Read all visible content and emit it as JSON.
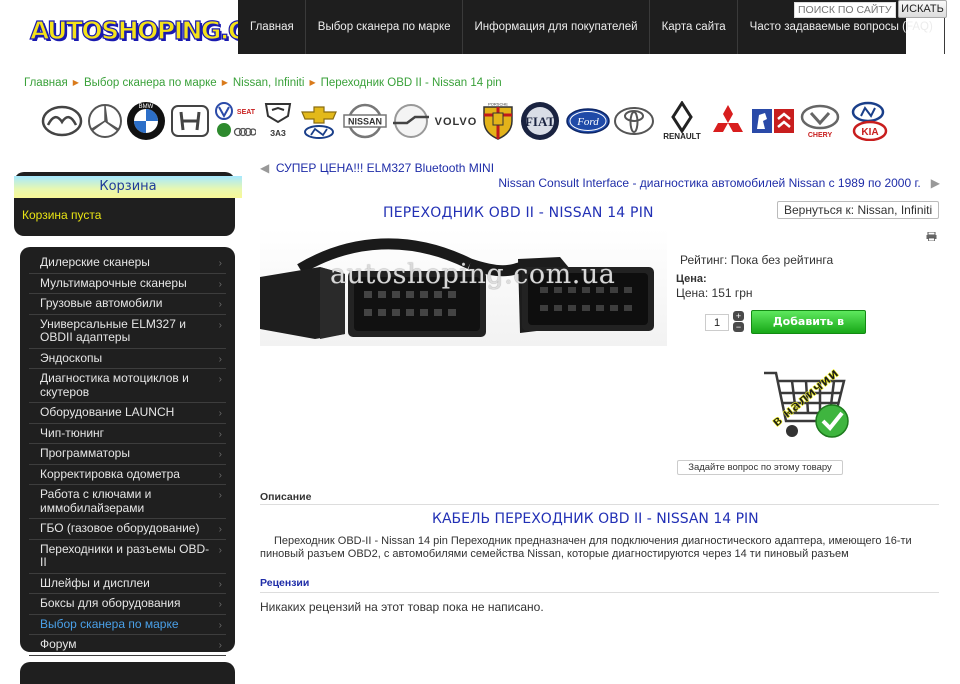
{
  "header": {
    "logo_text": "AUTOSHOPING.COM.UA",
    "nav": [
      "Главная",
      "Выбор сканера по марке",
      "Информация для покупателей",
      "Карта сайта",
      "Часто задаваемые вопросы (FAQ)"
    ],
    "search_placeholder": "ПОИСК ПО САЙТУ",
    "search_button": "ИСКАТЬ"
  },
  "breadcrumb": [
    "Главная",
    "Выбор сканера по марке",
    "Nissan, Infiniti",
    "Переходник OBD II - Nissan 14 pin"
  ],
  "brands": [
    {
      "name": "mazda",
      "text": ""
    },
    {
      "name": "mercedes",
      "text": ""
    },
    {
      "name": "bmw",
      "text": "BMW"
    },
    {
      "name": "honda",
      "text": "H"
    },
    {
      "name": "vw-skoda-seat-audi",
      "text": "SEAT"
    },
    {
      "name": "gaz-zaz",
      "text": "ЗАЗ"
    },
    {
      "name": "chevrolet-hyundai",
      "text": ""
    },
    {
      "name": "nissan",
      "text": "NISSAN"
    },
    {
      "name": "opel",
      "text": ""
    },
    {
      "name": "volvo",
      "text": "VOLVO"
    },
    {
      "name": "porsche",
      "text": "PORSCHE"
    },
    {
      "name": "fiat",
      "text": "FIAT"
    },
    {
      "name": "ford",
      "text": "Ford"
    },
    {
      "name": "toyota",
      "text": ""
    },
    {
      "name": "renault",
      "text": "RENAULT"
    },
    {
      "name": "mitsubishi",
      "text": ""
    },
    {
      "name": "peugeot-citroen",
      "text": ""
    },
    {
      "name": "chery",
      "text": "CHERY"
    },
    {
      "name": "hyundai-kia",
      "text": "KIA"
    }
  ],
  "sidebar": {
    "cart_title": "Корзина",
    "cart_empty": "Корзина пуста",
    "categories": [
      "Дилерские сканеры",
      "Мультимарочные сканеры",
      "Грузовые автомобили",
      "Универсальные ELM327 и OBDII адаптеры",
      "Эндоскопы",
      "Диагностика мотоциклов и скутеров",
      "Оборудование LAUNCH",
      "Чип-тюнинг",
      "Программаторы",
      "Корректировка одометра",
      "Работа с ключами и иммобилайзерами",
      "ГБО (газовое оборудование)",
      "Переходники и разъемы OBD-II",
      "Шлейфы и дисплеи",
      "Боксы для оборудования",
      "Выбор сканера по марке",
      "Форум"
    ],
    "active_index": 15
  },
  "product": {
    "prev": "СУПЕР ЦЕНА!!! ELM327 Bluetooth MINI",
    "next": "Nissan Consult Interface - диагностика автомобилей Nissan с 1989 по 2000 г.",
    "title": "ПЕРЕХОДНИК OBD II - NISSAN 14 PIN",
    "back": "Вернуться к: Nissan, Infiniti",
    "watermark": "autoshoping.com.ua",
    "rating": "Рейтинг: Пока без рейтинга",
    "price_label": "Цена:",
    "price": "Цена: 151 грн",
    "qty": "1",
    "add_to_cart": "Добавить в корзину",
    "in_stock": "в наличии",
    "ask": "Задайте вопрос по этому товару"
  },
  "description": {
    "label": "Описание",
    "title": "КАБЕЛЬ ПЕРЕХОДНИК OBD II - NISSAN 14 PIN",
    "body": "Переходник OBD-II - Nissan 14 pin    Переходник предназначен для подключения диагностического адаптера, имеющего 16-ти пиновый разъем OBD2, с автомобилями семейства Nissan, которые диагностируются через 14 ти пиновый разъем"
  },
  "reviews": {
    "label": "Рецензии",
    "empty": "Никаких рецензий на этот товар пока не написано."
  },
  "colors": {
    "accent_blue": "#2230b5",
    "breadcrumb_green": "#3aa13a",
    "sidebar_bg": "#1f1f1f",
    "cart_empty": "#e8e414",
    "add_button": "#18a818"
  }
}
